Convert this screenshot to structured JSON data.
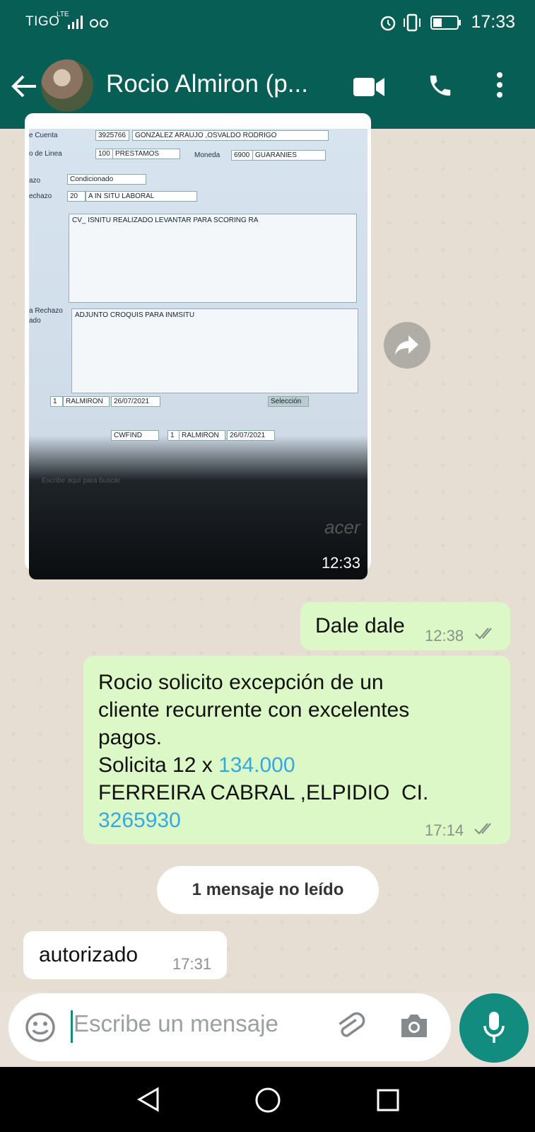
{
  "status_bar": {
    "carrier": "TIGO",
    "network": "LTE",
    "time": "17:33"
  },
  "header": {
    "contact_name": "Rocio Almiron (p...",
    "icons": [
      "back-arrow-icon",
      "video-call-icon",
      "phone-icon",
      "more-vert-icon"
    ]
  },
  "image_message": {
    "time": "12:33",
    "screen": {
      "cuenta_label": "e Cuenta",
      "cuenta_num": "3925766",
      "cuenta_name": "GONZALEZ ARAUJO ,OSVALDO RODRIGO",
      "linea_label": "o de Linea",
      "linea_num": "100",
      "linea_name": "PRESTAMOS",
      "moneda_label": "Moneda",
      "moneda_num": "6900",
      "moneda_name": "GUARANIES",
      "rechazo_type_label": "azo",
      "rechazo_type": "Condicionado",
      "rechazo_label": "echazo",
      "rechazo_num": "20",
      "rechazo_name": "A IN SITU LABORAL",
      "obs_text": "CV_ ISNITU REALIZADO LEVANTAR PARA SCORING RA",
      "obs2_label": "a Rechazo",
      "obs2_label2": "ado",
      "obs2_text": "ADJUNTO CROQUIS PARA INMSITU",
      "row1_num": "1",
      "row1_user": "RALMIRON",
      "row1_date": "26/07/2021",
      "sel_label": "Selección",
      "row2_code": "CWFIND",
      "row2_num": "1",
      "row2_user": "RALMIRON",
      "row2_date": "26/07/2021",
      "taskbar_search": "Escribe aquí para buscar",
      "brand": "acer"
    }
  },
  "messages": [
    {
      "id": "m1",
      "direction": "out",
      "text": "Dale dale",
      "time": "12:38",
      "ticks": "double-check-icon"
    },
    {
      "id": "m2",
      "direction": "out",
      "line1": "Rocio solicito excepción de un",
      "line2": "cliente recurrente con excelentes",
      "line3": "pagos.",
      "line4_a": "Solicita 12 x ",
      "line4_b": "134.000",
      "line5": "FERREIRA CABRAL ,ELPIDIO  CI.",
      "line6": "3265930",
      "time": "17:14",
      "ticks": "double-check-icon"
    },
    {
      "id": "m3",
      "direction": "in",
      "text": "autorizado",
      "time": "17:31"
    }
  ],
  "unread_divider": "1 mensaje no leído",
  "composer": {
    "placeholder": "Escribe un mensaje",
    "icons": [
      "emoji-icon",
      "attach-icon",
      "camera-icon",
      "mic-icon"
    ]
  },
  "colors": {
    "header": "#075e54",
    "accent": "#128c7e",
    "outgoing_bubble": "#dcf8c6",
    "link_number": "#34a9e0"
  }
}
